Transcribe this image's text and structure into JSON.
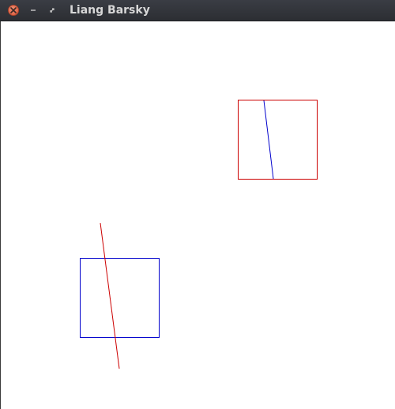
{
  "window": {
    "title": "Liang Barsky",
    "controls": {
      "close_icon": "close-icon",
      "minimize_icon": "minimize-icon",
      "maximize_icon": "maximize-icon"
    }
  },
  "canvas": {
    "background": "#ffffff",
    "colors": {
      "red": "#cc0000",
      "blue": "#0000cc"
    }
  }
}
